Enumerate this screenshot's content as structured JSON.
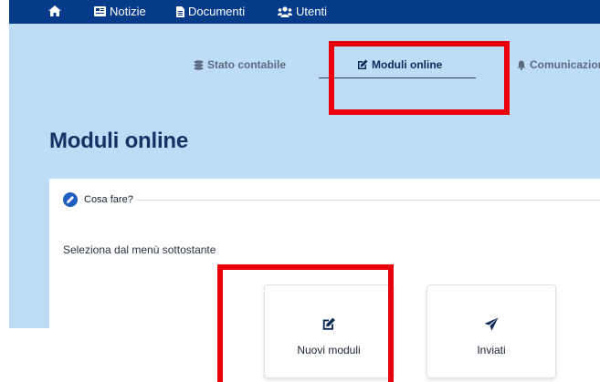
{
  "topnav": {
    "home_icon": "home-icon",
    "items": [
      {
        "label": "Notizie",
        "icon": "newspaper-icon"
      },
      {
        "label": "Documenti",
        "icon": "file-icon"
      },
      {
        "label": "Utenti",
        "icon": "users-icon"
      }
    ]
  },
  "tabs": [
    {
      "label": "Stato contabile",
      "icon": "coins-icon",
      "active": false
    },
    {
      "label": "Moduli online",
      "icon": "edit-icon",
      "active": true
    },
    {
      "label": "Comunicazioni",
      "icon": "bell-icon",
      "active": false
    }
  ],
  "page": {
    "title": "Moduli online"
  },
  "section": {
    "legend": "Cosa fare?",
    "legend_icon": "pencil-icon",
    "instructions": "Seleziona dal menù sottostante"
  },
  "tiles": [
    {
      "label": "Nuovi moduli",
      "icon": "edit-icon"
    },
    {
      "label": "Inviati",
      "icon": "send-icon"
    }
  ],
  "colors": {
    "nav_bg": "#063b8a",
    "band_bg": "#bfdcf7",
    "title": "#123363",
    "highlight": "#e8000a"
  }
}
